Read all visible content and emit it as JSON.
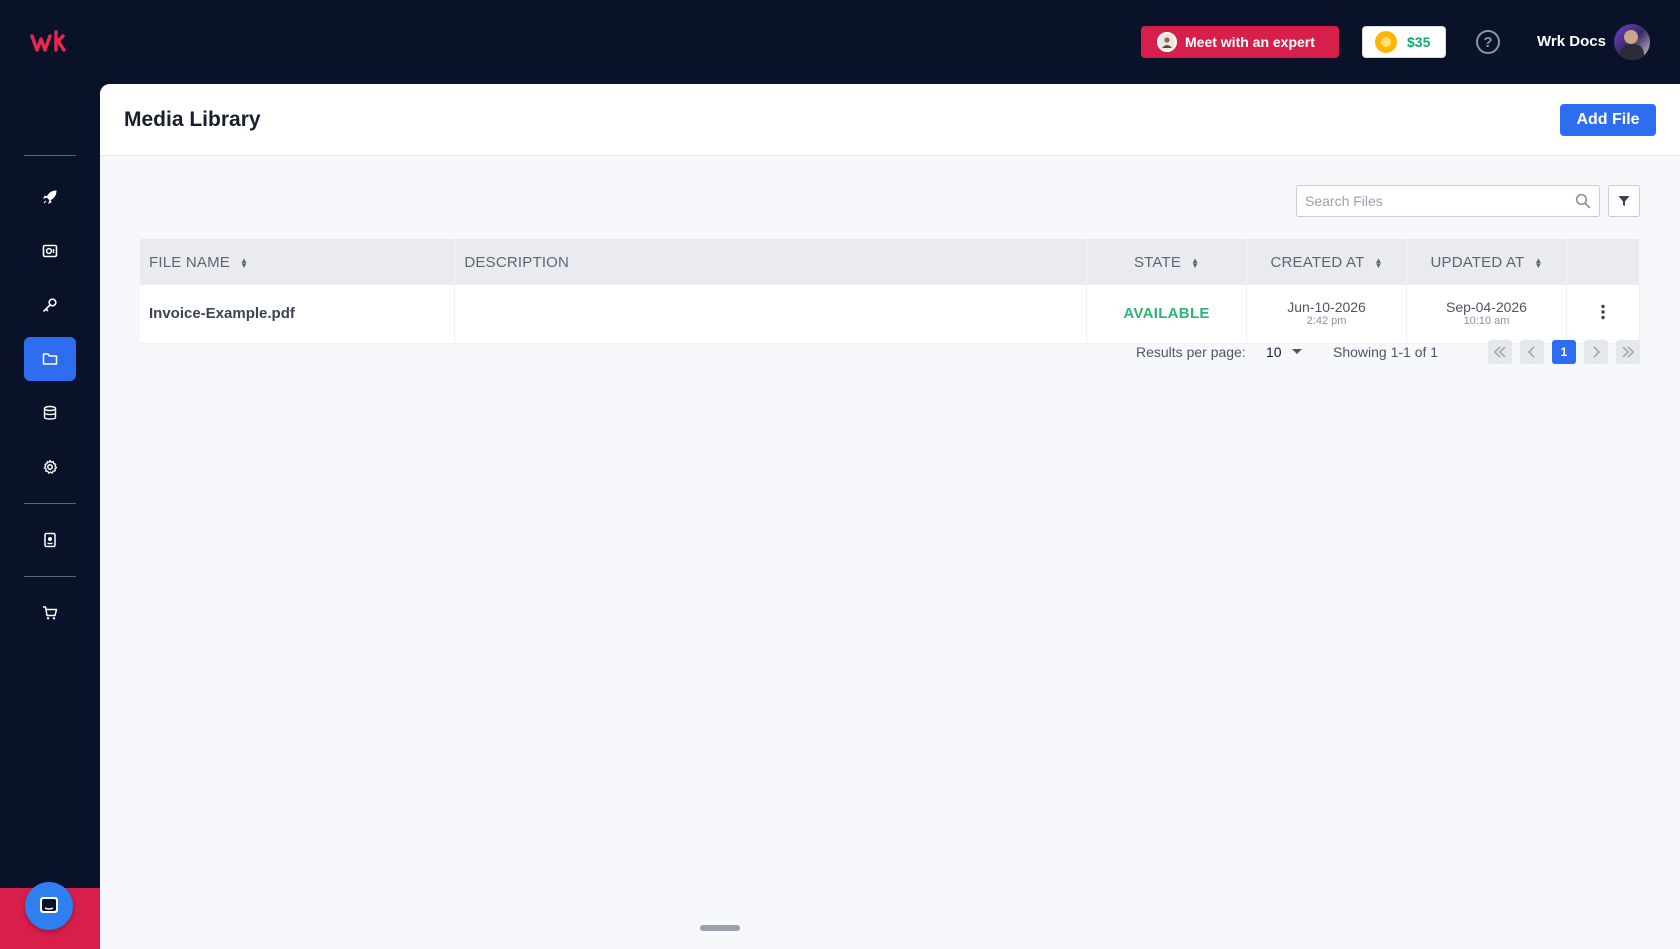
{
  "header": {
    "logo_text": "wk",
    "expert_button": "Meet with an expert",
    "credits": "$35",
    "help_glyph": "?",
    "user_name": "Wrk Docs"
  },
  "sidebar": {
    "items": [
      {
        "icon": "rocket-icon"
      },
      {
        "icon": "monitor-icon"
      },
      {
        "icon": "key-icon"
      },
      {
        "icon": "folder-icon",
        "active": true
      },
      {
        "icon": "database-icon"
      },
      {
        "icon": "gear-icon"
      },
      {
        "icon": "document-icon"
      },
      {
        "icon": "cart-icon"
      }
    ]
  },
  "page": {
    "title": "Media Library",
    "add_file": "Add File",
    "search_placeholder": "Search Files"
  },
  "table": {
    "columns": [
      "FILE NAME",
      "DESCRIPTION",
      "STATE",
      "CREATED AT",
      "UPDATED AT"
    ],
    "rows": [
      {
        "file_name": "Invoice-Example.pdf",
        "description": "",
        "state": "AVAILABLE",
        "created_date": "Jun-10-2026",
        "created_time": "2:42 pm",
        "updated_date": "Sep-04-2026",
        "updated_time": "10:10 am"
      }
    ]
  },
  "pagination": {
    "results_label": "Results per page:",
    "per_page": "10",
    "showing": "Showing 1-1 of 1",
    "current_page": "1"
  },
  "colors": {
    "accent": "#2e6cf0",
    "brand_red": "#d81f4c",
    "nav_bg": "#0a1229",
    "state_available": "#2bb673"
  }
}
